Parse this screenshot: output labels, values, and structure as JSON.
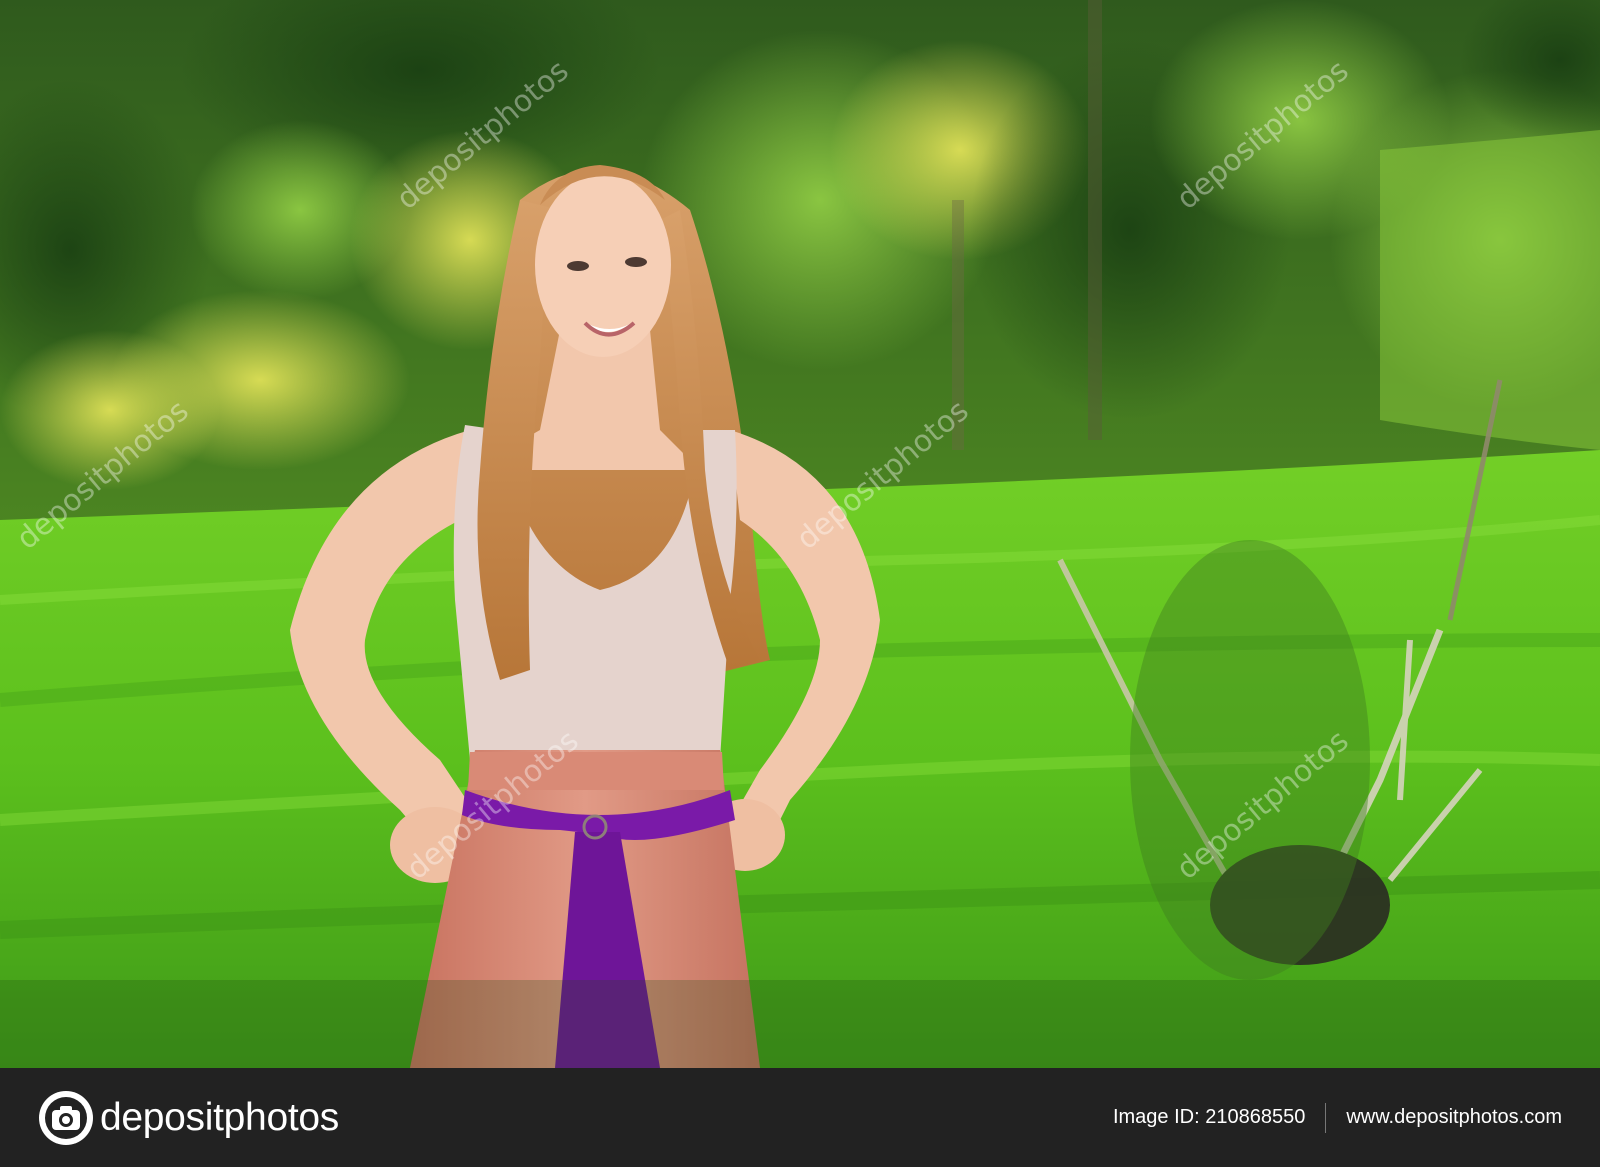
{
  "photo": {
    "subject": "woman",
    "watermark_text": "depositphotos"
  },
  "footer": {
    "brand": "depositphotos",
    "image_id": "Image ID: 210868550",
    "website": "www.depositphotos.com"
  },
  "colors": {
    "footer_bg": "#222222",
    "grass": "#5fc21e",
    "foliage": "#2e6a1d",
    "skirt": "#d98a76",
    "sash": "#7a1aa8",
    "top": "#e5d3cd",
    "hair": "#c88a55"
  }
}
